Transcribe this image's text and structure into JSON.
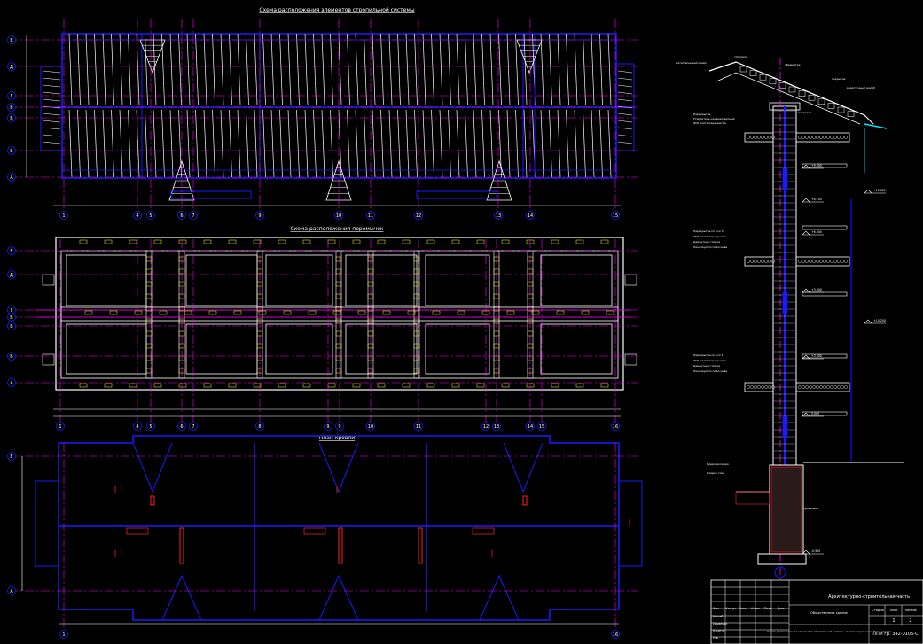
{
  "colors": {
    "background": "#000000",
    "blue": "#1a1aff",
    "white": "#ffffff",
    "magenta": "#ff00ff",
    "red": "#ff2020",
    "cyan": "#00e5ff",
    "yellow": "#ffff00",
    "green": "#00ff00",
    "grey": "#9a9a9a"
  },
  "titles": {
    "plan1": "Схема расположения элементов стропильной системы",
    "plan2": "Схема расположения перемычек",
    "plan3": "План кровли"
  },
  "grid_axes": {
    "columns": [
      "1",
      "4",
      "5",
      "6",
      "7",
      "9",
      "10",
      "11",
      "12",
      "13",
      "14",
      "15"
    ],
    "columns_plan2": [
      "1",
      "4",
      "5",
      "6",
      "7",
      "8",
      "9",
      "10",
      "11",
      "12",
      "13",
      "14",
      "15"
    ],
    "rows": [
      "Е",
      "Д",
      "Г",
      "В",
      "Б",
      "А"
    ],
    "rows_short": [
      "Е",
      "А"
    ]
  },
  "section_labels": [
    "металлический конёк",
    "стропила",
    "обрешётка",
    "покрытие",
    "мауэрлат",
    "водосточный желоб",
    "Перекрытие",
    "Утеплитель минераловатный",
    "Ж/б плита перекрытия",
    "Перекрытие по оси 3",
    "Ж/б плита перекрытия",
    "Цементная стяжка",
    "Линолеум по подоснове",
    "Перекрытие по оси 1",
    "Ж/б плита перекрытия",
    "Цементная стяжка",
    "Линолеум по подоснове",
    "Гидроизоляция",
    "Кладка стен",
    "Фундамент"
  ],
  "levels": [
    "+9.600",
    "+8.700",
    "+6.000",
    "+3.000",
    "0.000",
    "-0.900",
    "+12.600",
    "+10.200"
  ],
  "title_block": {
    "project": "Архитектурно-строительная часть",
    "sheet_title": "Схема расположения элементов стропильной системы. Схема перемычек. План кровли",
    "stage_label": "Стадия",
    "sheet_label": "Лист",
    "sheets_label": "Листов",
    "sheet": "1",
    "sheets": "2",
    "code": "ППИ гр. 342-0105-С",
    "object": "Общественное здание",
    "roles": [
      "Изм.",
      "Кол.уч",
      "Лист",
      "№док",
      "Подп.",
      "Дата",
      "Разраб.",
      "Проверил",
      "Н.контр.",
      "Утв."
    ]
  }
}
